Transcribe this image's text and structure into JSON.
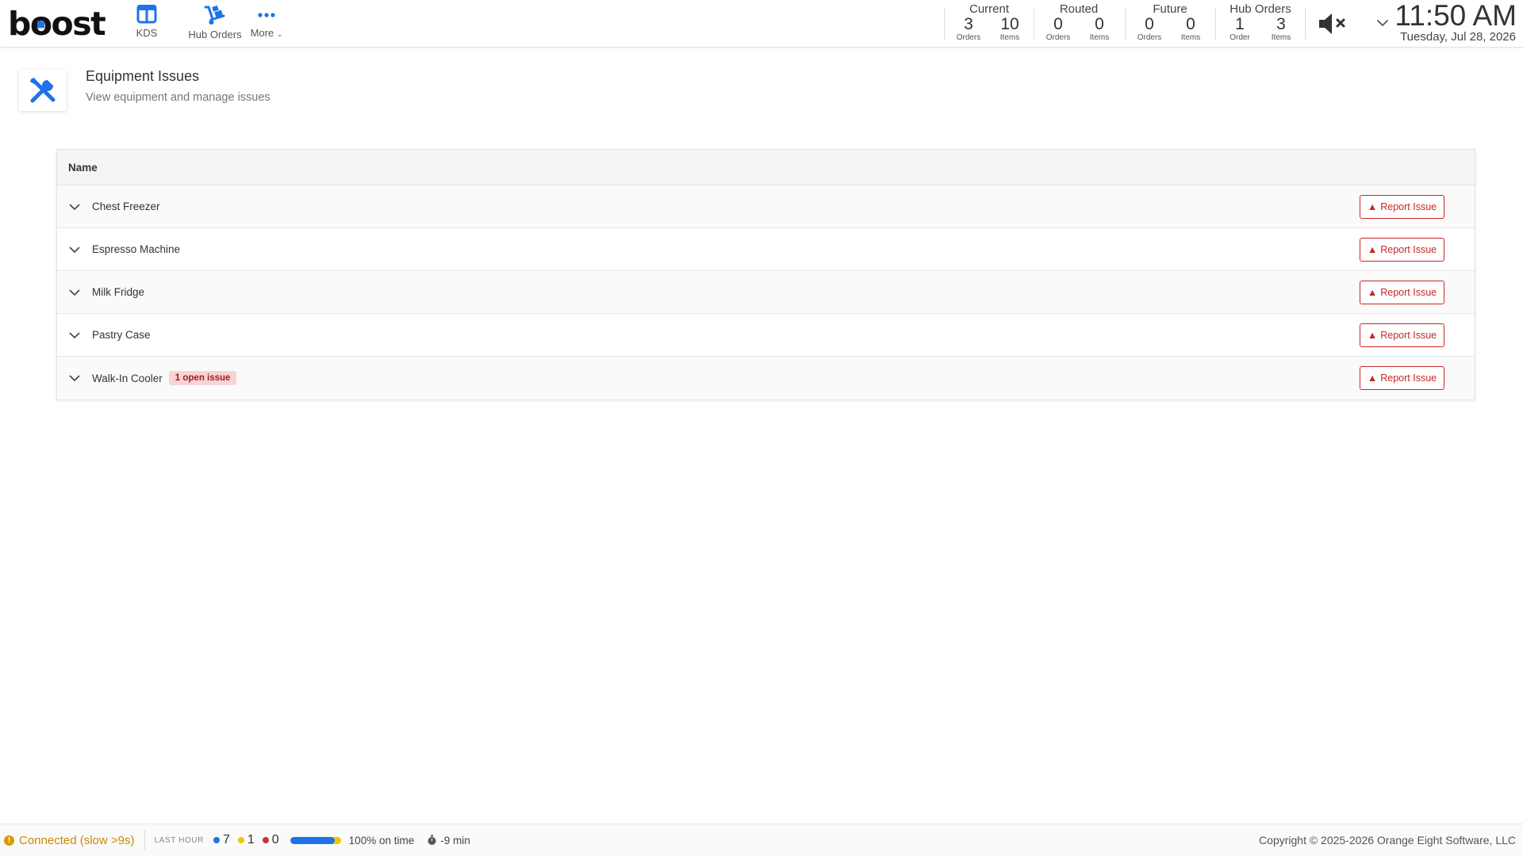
{
  "header": {
    "logo": {
      "part1": "b",
      "part2": "o",
      "part3": "ost"
    },
    "nav": [
      {
        "label": "KDS"
      },
      {
        "label": "Hub Orders"
      },
      {
        "label": "More"
      }
    ],
    "stats": [
      {
        "title": "Current",
        "cols": [
          {
            "num": "3",
            "unit": "Orders"
          },
          {
            "num": "10",
            "unit": "Items"
          }
        ]
      },
      {
        "title": "Routed",
        "cols": [
          {
            "num": "0",
            "unit": "Orders"
          },
          {
            "num": "0",
            "unit": "Items"
          }
        ]
      },
      {
        "title": "Future",
        "cols": [
          {
            "num": "0",
            "unit": "Orders"
          },
          {
            "num": "0",
            "unit": "Items"
          }
        ]
      },
      {
        "title": "Hub Orders",
        "cols": [
          {
            "num": "1",
            "unit": "Order"
          },
          {
            "num": "3",
            "unit": "Items"
          }
        ]
      }
    ],
    "time": "11:50 AM",
    "date": "Tuesday, Jul 28, 2026"
  },
  "page": {
    "title": "Equipment Issues",
    "subtitle": "View equipment and manage issues"
  },
  "table": {
    "column": "Name",
    "report_label": "Report Issue",
    "rows": [
      {
        "name": "Chest Freezer",
        "badge": ""
      },
      {
        "name": "Espresso Machine",
        "badge": ""
      },
      {
        "name": "Milk Fridge",
        "badge": ""
      },
      {
        "name": "Pastry Case",
        "badge": ""
      },
      {
        "name": "Walk-In Cooler",
        "badge": "1 open issue"
      }
    ]
  },
  "footer": {
    "connection": "Connected (slow >9s)",
    "last_hour": "LAST HOUR",
    "counts": [
      {
        "value": "7",
        "color": "#1e73e8"
      },
      {
        "value": "1",
        "color": "#f3c400"
      },
      {
        "value": "0",
        "color": "#d32f2f"
      }
    ],
    "on_time_percent": 88,
    "on_time": "100% on time",
    "avg": "-9 min",
    "copyright": "Copyright © 2025-2026 Orange Eight Software, LLC"
  },
  "colors": {
    "accent": "#1e73e8",
    "danger": "#c62828",
    "warning": "#c98a00"
  }
}
